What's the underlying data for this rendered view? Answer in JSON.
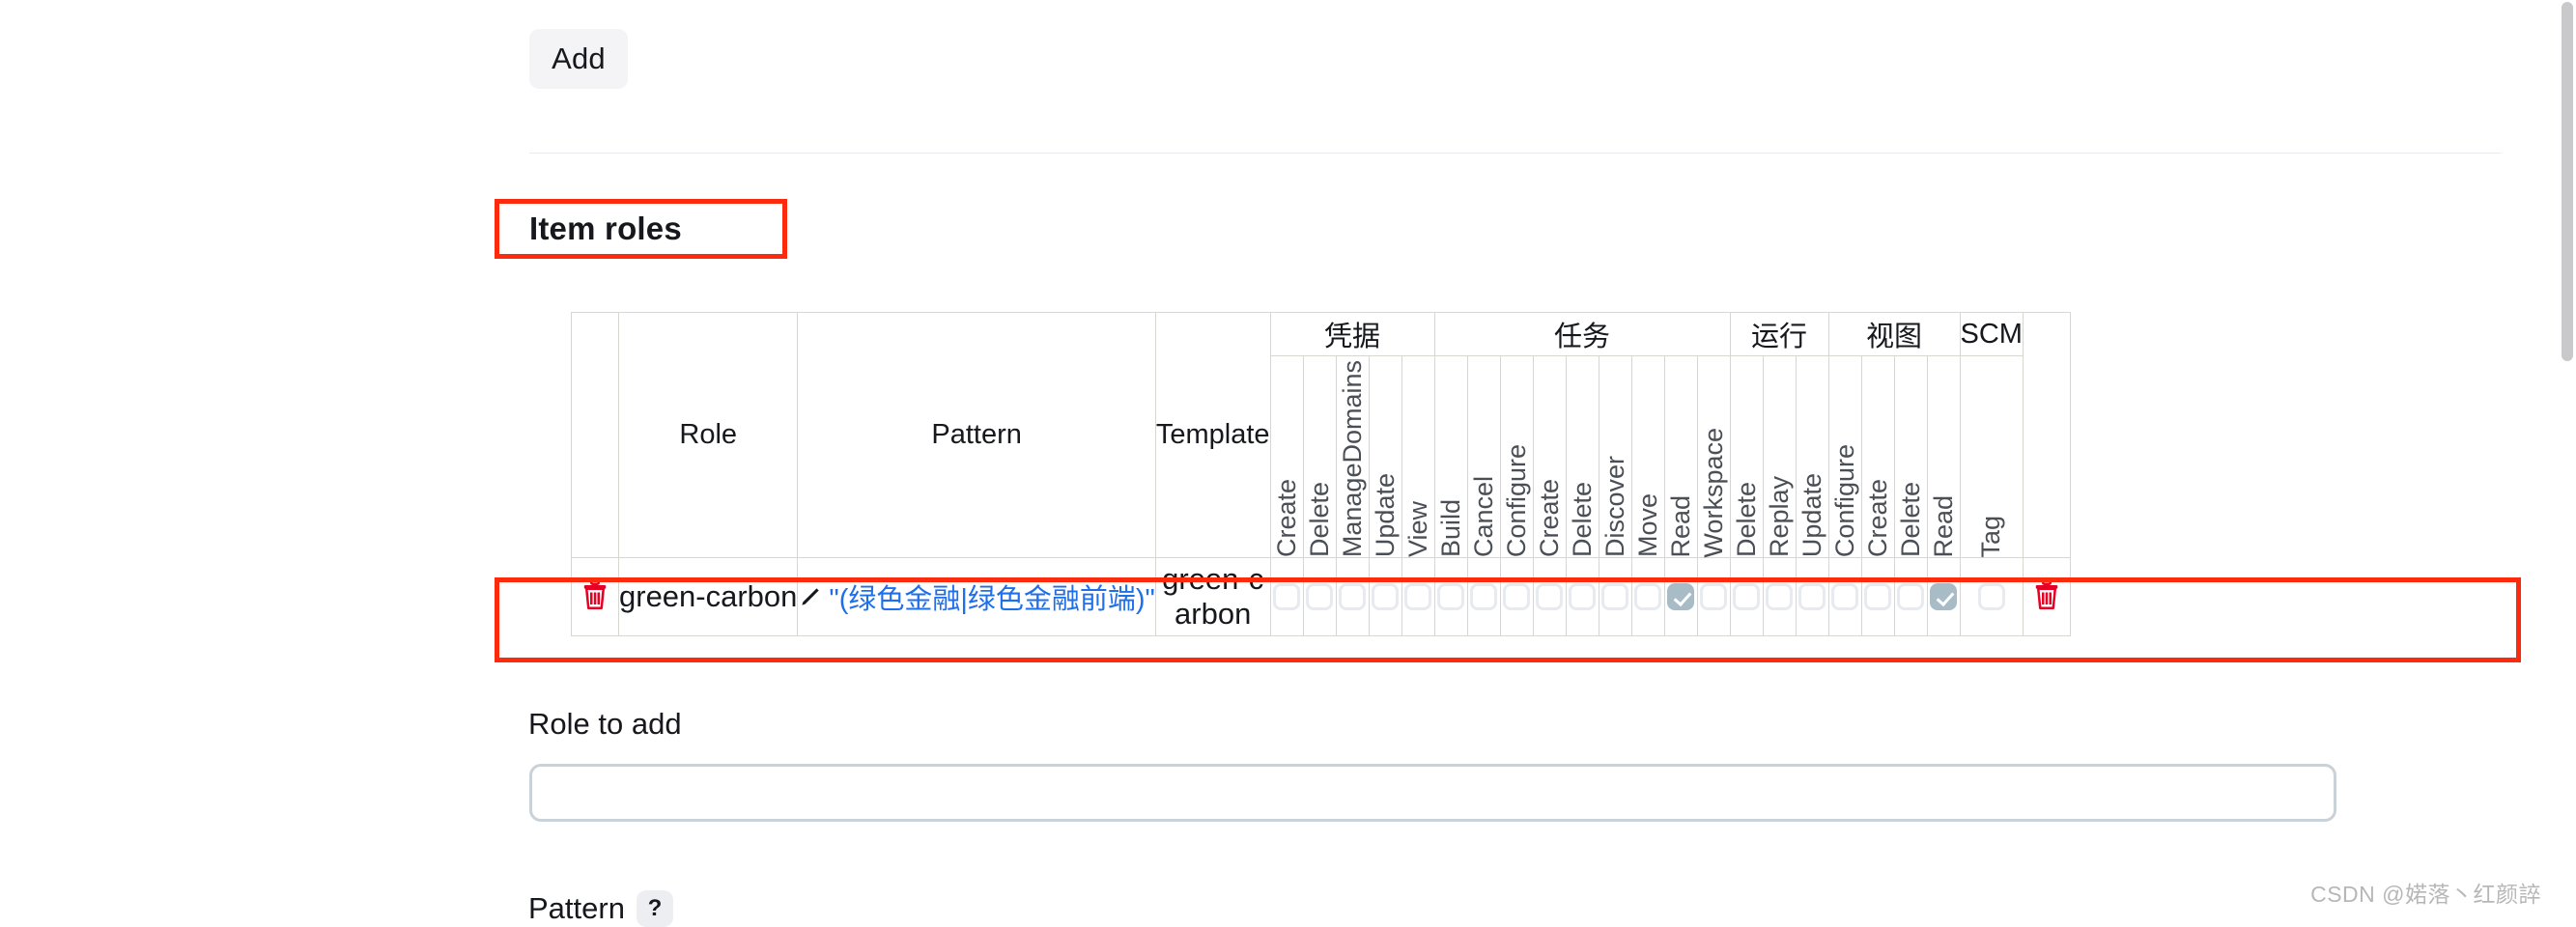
{
  "toolbar": {
    "add_label": "Add"
  },
  "section": {
    "title": "Item roles"
  },
  "table": {
    "column_headers": {
      "role": "Role",
      "pattern": "Pattern",
      "template": "Template"
    },
    "groups": [
      {
        "label": "凭据",
        "columns": [
          "Create",
          "Delete",
          "ManageDomains",
          "Update",
          "View"
        ]
      },
      {
        "label": "任务",
        "columns": [
          "Build",
          "Cancel",
          "Configure",
          "Create",
          "Delete",
          "Discover",
          "Move",
          "Read",
          "Workspace"
        ]
      },
      {
        "label": "运行",
        "columns": [
          "Delete",
          "Replay",
          "Update"
        ]
      },
      {
        "label": "视图",
        "columns": [
          "Configure",
          "Create",
          "Delete",
          "Read"
        ]
      },
      {
        "label": "SCM",
        "columns": [
          "Tag"
        ]
      }
    ],
    "rows": [
      {
        "role": "green-carbon",
        "pattern": "\"(绿色金融|绿色金融前端)\"",
        "template": "green-carbon",
        "permissions": [
          false,
          false,
          false,
          false,
          false,
          false,
          false,
          false,
          false,
          false,
          false,
          false,
          true,
          false,
          false,
          false,
          false,
          false,
          false,
          false,
          true,
          false
        ],
        "delete_icon_left": "trash-icon",
        "delete_icon_right": "trash-icon",
        "edit_icon": "pencil-icon"
      }
    ]
  },
  "form": {
    "role_to_add_label": "Role to add",
    "role_to_add_value": "",
    "role_to_add_placeholder": "",
    "pattern_label": "Pattern",
    "pattern_help": "?"
  },
  "colors": {
    "highlight": "#fd2b0d",
    "checked_checkbox": "#a7bcc7",
    "link": "#1f6feb",
    "header_bg": "#f2f2f7",
    "trash": "#e60023"
  },
  "watermark": {
    "text": "CSDN @婼落丶红颜誶"
  }
}
